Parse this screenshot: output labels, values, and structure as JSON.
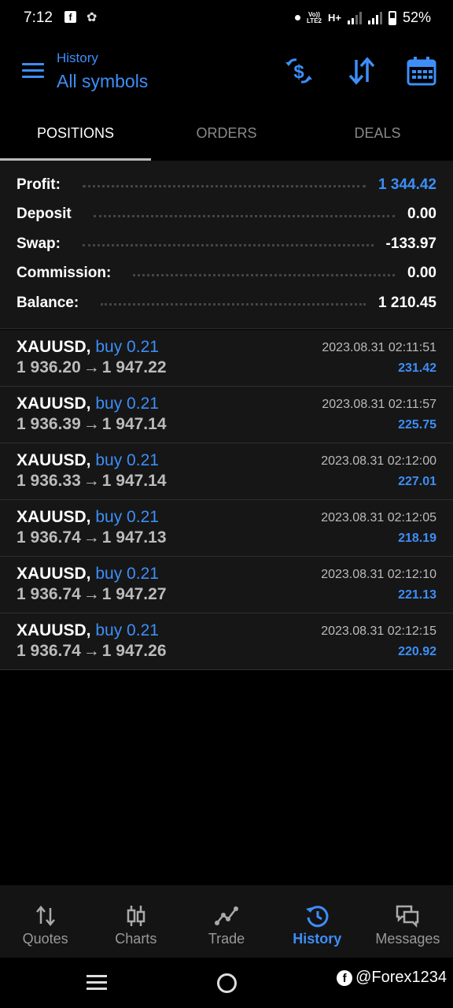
{
  "status_bar": {
    "time": "7:12",
    "network_label_top": "Vo))",
    "network_label_bottom": "LTE2",
    "network_type": "H+",
    "battery": "52%"
  },
  "header": {
    "subtitle": "History",
    "title": "All symbols",
    "icons": [
      "currency-exchange-icon",
      "sort-icon",
      "calendar-icon"
    ]
  },
  "tabs": [
    {
      "label": "POSITIONS",
      "active": true
    },
    {
      "label": "ORDERS",
      "active": false
    },
    {
      "label": "DEALS",
      "active": false
    }
  ],
  "summary": {
    "profit_label": "Profit:",
    "profit_value": "1 344.42",
    "deposit_label": "Deposit",
    "deposit_value": "0.00",
    "swap_label": "Swap:",
    "swap_value": "-133.97",
    "commission_label": "Commission:",
    "commission_value": "0.00",
    "balance_label": "Balance:",
    "balance_value": "1 210.45"
  },
  "deals": [
    {
      "symbol": "XAUUSD,",
      "type": "buy 0.21",
      "open": "1 936.20",
      "arrow": "→",
      "close": "1 947.22",
      "time": "2023.08.31 02:11:51",
      "profit": "231.42"
    },
    {
      "symbol": "XAUUSD,",
      "type": "buy 0.21",
      "open": "1 936.39",
      "arrow": "→",
      "close": "1 947.14",
      "time": "2023.08.31 02:11:57",
      "profit": "225.75"
    },
    {
      "symbol": "XAUUSD,",
      "type": "buy 0.21",
      "open": "1 936.33",
      "arrow": "→",
      "close": "1 947.14",
      "time": "2023.08.31 02:12:00",
      "profit": "227.01"
    },
    {
      "symbol": "XAUUSD,",
      "type": "buy 0.21",
      "open": "1 936.74",
      "arrow": "→",
      "close": "1 947.13",
      "time": "2023.08.31 02:12:05",
      "profit": "218.19"
    },
    {
      "symbol": "XAUUSD,",
      "type": "buy 0.21",
      "open": "1 936.74",
      "arrow": "→",
      "close": "1 947.27",
      "time": "2023.08.31 02:12:10",
      "profit": "221.13"
    },
    {
      "symbol": "XAUUSD,",
      "type": "buy 0.21",
      "open": "1 936.74",
      "arrow": "→",
      "close": "1 947.26",
      "time": "2023.08.31 02:12:15",
      "profit": "220.92"
    }
  ],
  "bottom_nav": [
    {
      "label": "Quotes",
      "icon": "quotes-icon",
      "active": false
    },
    {
      "label": "Charts",
      "icon": "charts-icon",
      "active": false
    },
    {
      "label": "Trade",
      "icon": "trade-icon",
      "active": false
    },
    {
      "label": "History",
      "icon": "history-icon",
      "active": true
    },
    {
      "label": "Messages",
      "icon": "messages-icon",
      "active": false
    }
  ],
  "watermark": "@Forex1234",
  "colors": {
    "accent": "#3d8ef8",
    "background": "#000000",
    "panel": "#161616"
  }
}
